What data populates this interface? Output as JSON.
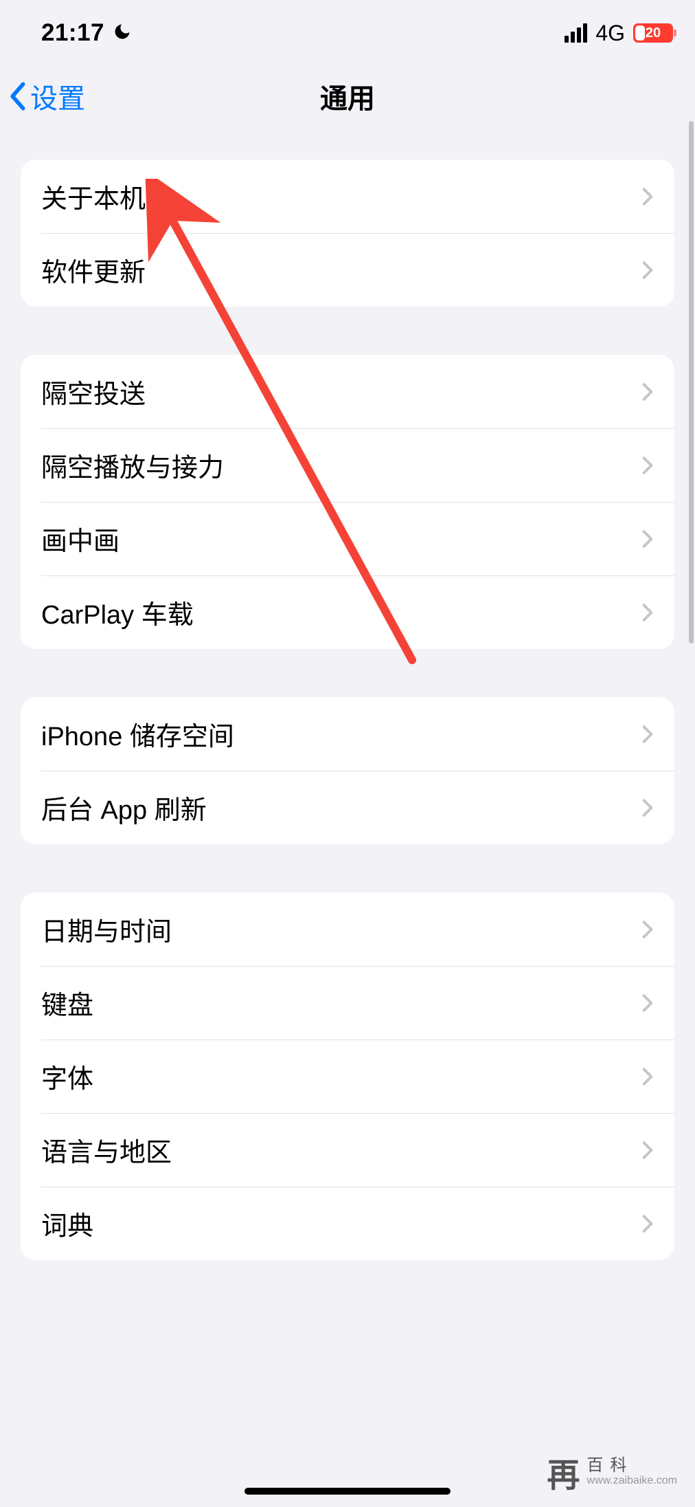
{
  "status": {
    "time": "21:17",
    "network": "4G",
    "battery_pct": "20"
  },
  "nav": {
    "back": "设置",
    "title": "通用"
  },
  "groups": [
    {
      "rows": [
        "关于本机",
        "软件更新"
      ]
    },
    {
      "rows": [
        "隔空投送",
        "隔空播放与接力",
        "画中画",
        "CarPlay 车载"
      ]
    },
    {
      "rows": [
        "iPhone 储存空间",
        "后台 App 刷新"
      ]
    },
    {
      "rows": [
        "日期与时间",
        "键盘",
        "字体",
        "语言与地区",
        "词典"
      ]
    }
  ],
  "watermark": {
    "logo": "再",
    "cn": "百科",
    "url": "www.zaibaike.com"
  }
}
